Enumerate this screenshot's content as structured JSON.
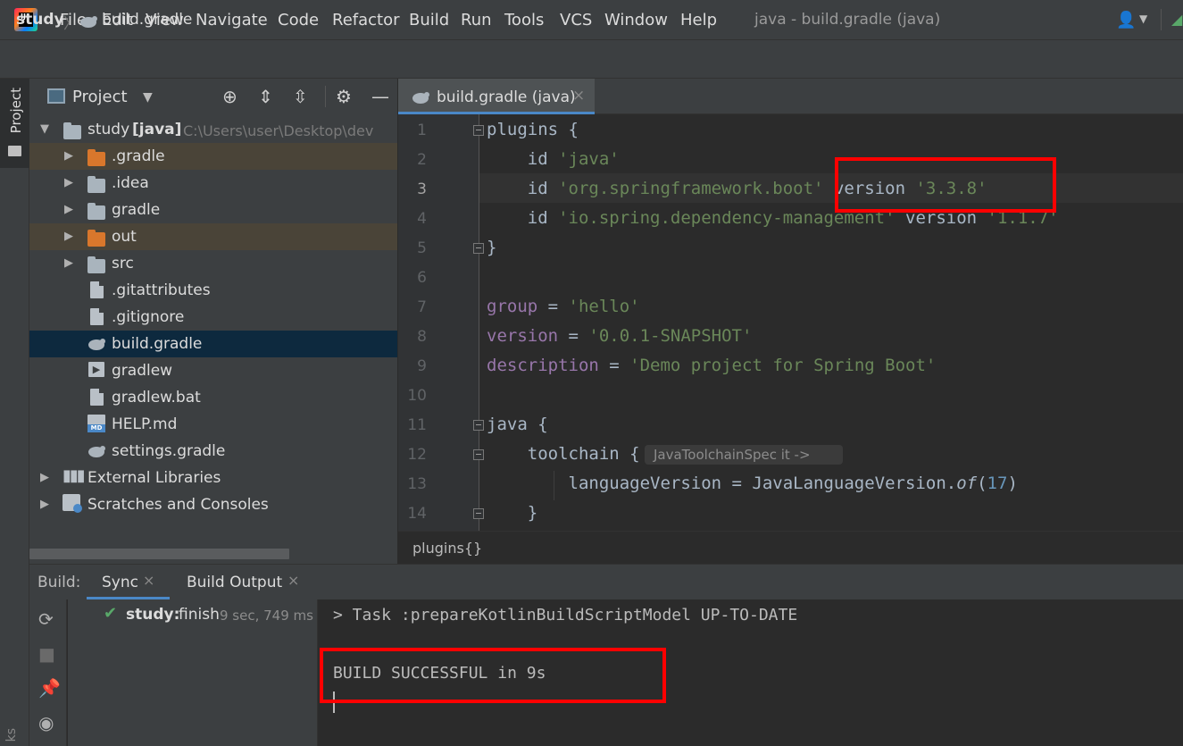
{
  "menubar": {
    "items": [
      "File",
      "Edit",
      "View",
      "Navigate",
      "Code",
      "Refactor",
      "Build",
      "Run",
      "Tools",
      "VCS",
      "Window",
      "Help"
    ],
    "window_title": "java - build.gradle (java)"
  },
  "navbar": {
    "project": "study",
    "file": "build.gradle"
  },
  "left_strip": {
    "project_tab": "Project",
    "bottom_tab": "ks"
  },
  "project_panel": {
    "title": "Project",
    "tree": [
      {
        "label": "study",
        "tag": "[java]",
        "path": "C:\\Users\\user\\Desktop\\dev"
      },
      {
        "label": ".gradle"
      },
      {
        "label": ".idea"
      },
      {
        "label": "gradle"
      },
      {
        "label": "out"
      },
      {
        "label": "src"
      },
      {
        "label": ".gitattributes"
      },
      {
        "label": ".gitignore"
      },
      {
        "label": "build.gradle"
      },
      {
        "label": "gradlew"
      },
      {
        "label": "gradlew.bat"
      },
      {
        "label": "HELP.md"
      },
      {
        "label": "settings.gradle"
      },
      {
        "label": "External Libraries"
      },
      {
        "label": "Scratches and Consoles"
      }
    ]
  },
  "editor": {
    "tab_label": "build.gradle (java)",
    "tab_close": "×",
    "line_numbers": [
      "1",
      "2",
      "3",
      "4",
      "5",
      "6",
      "7",
      "8",
      "9",
      "10",
      "11",
      "12",
      "13",
      "14"
    ],
    "lines": {
      "l1": {
        "a": "plugins {"
      },
      "l2": {
        "a": "    id ",
        "b": "'java'"
      },
      "l3": {
        "a": "    id ",
        "b": "'org.springframework.boot'",
        "c": " version ",
        "d": "'3.3.8'"
      },
      "l4": {
        "a": "    id ",
        "b": "'io.spring.dependency-management'",
        "c": " version ",
        "d": "'1.1.7'"
      },
      "l5": {
        "a": "}"
      },
      "l7": {
        "a": "group",
        "b": " = ",
        "c": "'hello'"
      },
      "l8": {
        "a": "version",
        "b": " = ",
        "c": "'0.0.1-SNAPSHOT'"
      },
      "l9": {
        "a": "description",
        "b": " = ",
        "c": "'Demo project for Spring Boot'"
      },
      "l11": {
        "a": "java {"
      },
      "l12": {
        "a": "    toolchain {"
      },
      "l13": {
        "a": "        languageVersion = JavaLanguageVersion.",
        "b": "of",
        "c": "(",
        "d": "17",
        "e": ")"
      },
      "l14": {
        "a": "    }"
      }
    },
    "inlay_hint": "JavaToolchainSpec it ->",
    "breadcrumb": "plugins{}"
  },
  "build_panel": {
    "label": "Build:",
    "tabs": [
      {
        "label": "Sync",
        "close": "×"
      },
      {
        "label": "Build Output",
        "close": "×"
      }
    ],
    "status": {
      "name": "study:",
      "text": "finish",
      "time": "9 sec, 749 ms"
    },
    "console": [
      "> Task :prepareKotlinBuildScriptModel UP-TO-DATE",
      "BUILD SUCCESSFUL in 9s"
    ]
  },
  "colors": {
    "accent": "#4a88c7",
    "highlight_box": "#ff0000",
    "success": "#59a869"
  }
}
